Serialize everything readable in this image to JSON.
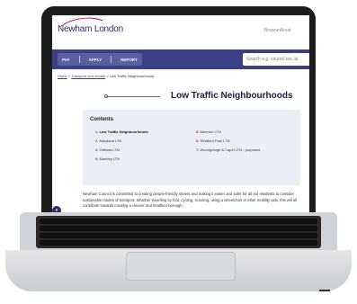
{
  "header": {
    "logo_text": "Newham London",
    "browsealoud": "BrowseAloud"
  },
  "nav": {
    "items": [
      "PAY",
      "APPLY",
      "REPORT"
    ],
    "search_placeholder": "Search e.g. council tax, bi"
  },
  "breadcrumb": {
    "home": "Home",
    "sep": ">",
    "parent": "Transport and streets",
    "current": "Low Traffic Neighbourhoods"
  },
  "page": {
    "title": "Low Traffic Neighbourhoods"
  },
  "contents": {
    "title": "Contents",
    "left": [
      {
        "num": "1.",
        "label": "Low Traffic Neighbourhoods"
      },
      {
        "num": "2.",
        "label": "Maryland LTN"
      },
      {
        "num": "3.",
        "label": "Odessa LTN"
      },
      {
        "num": "4.",
        "label": "Manbey LTN"
      }
    ],
    "right": [
      {
        "num": "5.",
        "label": "Atherton LTN"
      },
      {
        "num": "6.",
        "label": "Stratford Park LTN"
      },
      {
        "num": "7.",
        "label": "Woodgrange & Capel LTN - proposed"
      }
    ]
  },
  "intro": "Newham Council is committed to creating people-friendly streets and making it easier and safer for all our residents to consider sustainable modes of transport. Whether travelling by foot, cycling, scooting, using a wheelchair or other mobility aids, this will all contribute towards creating a cleaner and healthier borough.",
  "accessibility_glyph": "e",
  "colors": {
    "nav_bg": "#3b3f86",
    "accent": "#b31b6a"
  }
}
